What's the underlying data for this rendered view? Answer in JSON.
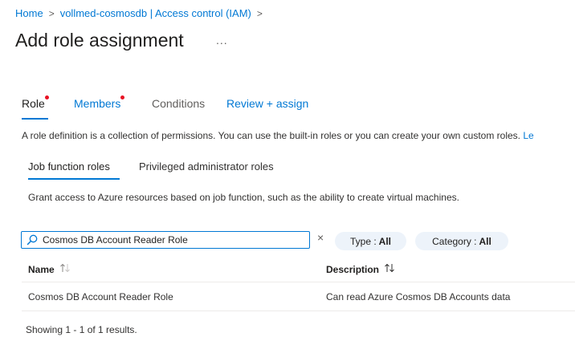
{
  "breadcrumb": {
    "items": [
      "Home",
      "vollmed-cosmosdb | Access control (IAM)"
    ],
    "separator": ">"
  },
  "page": {
    "title": "Add role assignment",
    "more_label": "..."
  },
  "tabs": {
    "role": "Role",
    "members": "Members",
    "conditions": "Conditions",
    "review": "Review + assign"
  },
  "description": {
    "text": "A role definition is a collection of permissions. You can use the built-in roles or you can create your own custom roles.",
    "link": "Le"
  },
  "subtabs": {
    "job_function": "Job function roles",
    "privileged": "Privileged administrator roles"
  },
  "grant_text": "Grant access to Azure resources based on job function, such as the ability to create virtual machines.",
  "search": {
    "value": "Cosmos DB Account Reader Role",
    "clear_label": "×"
  },
  "filters": {
    "type_label": "Type :",
    "type_value": "All",
    "category_label": "Category :",
    "category_value": "All"
  },
  "table": {
    "columns": [
      "Name",
      "Description"
    ],
    "rows": [
      {
        "name": "Cosmos DB Account Reader Role",
        "description": "Can read Azure Cosmos DB Accounts data"
      }
    ]
  },
  "footer": {
    "showing": "Showing 1 - 1 of 1 results."
  },
  "colors": {
    "accent": "#0078d4",
    "required_dot": "#e81123",
    "pill_bg": "#edf3fa"
  }
}
